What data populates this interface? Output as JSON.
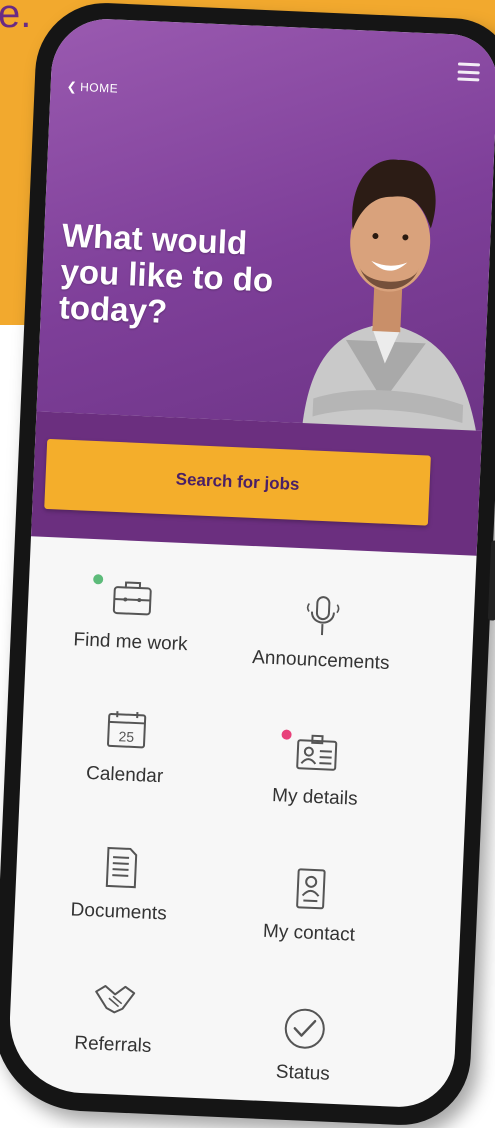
{
  "background_text": "e.",
  "nav": {
    "home_label": "HOME"
  },
  "hero": {
    "headline": "What would you like to do today?"
  },
  "search_button": {
    "label": "Search for jobs"
  },
  "tiles": [
    {
      "label": "Find me work",
      "icon": "briefcase-icon",
      "indicator": "#5dbb7a"
    },
    {
      "label": "Announcements",
      "icon": "microphone-icon"
    },
    {
      "label": "Calendar",
      "icon": "calendar-icon",
      "day": "25"
    },
    {
      "label": "My details",
      "icon": "id-card-icon",
      "indicator": "#e8407a"
    },
    {
      "label": "Documents",
      "icon": "document-icon"
    },
    {
      "label": "My contact",
      "icon": "contact-card-icon"
    },
    {
      "label": "Referrals",
      "icon": "handshake-icon"
    },
    {
      "label": "Status",
      "icon": "check-circle-icon"
    }
  ],
  "colors": {
    "orange": "#f2a92e",
    "purple": "#7e3f99",
    "dark_purple": "#6b2f7f",
    "button": "#f4ae2b"
  }
}
